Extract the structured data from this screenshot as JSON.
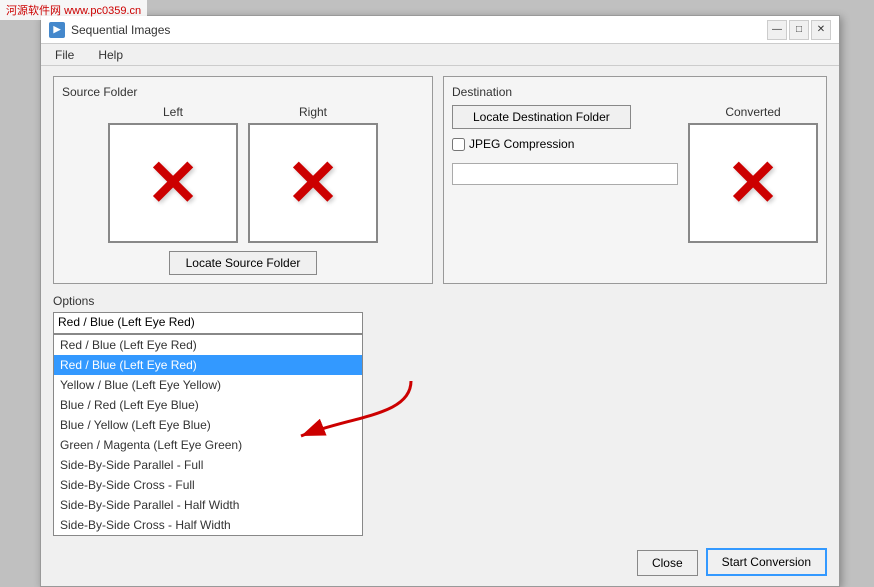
{
  "watermark": {
    "site": "www.pc0359.cn",
    "label": "河源软件网"
  },
  "window": {
    "title": "Sequential Images",
    "menu": {
      "file": "File",
      "help": "Help"
    }
  },
  "source_panel": {
    "title": "Source Folder",
    "left_label": "Left",
    "right_label": "Right",
    "locate_btn": "Locate Source Folder"
  },
  "dest_panel": {
    "title": "Destination",
    "converted_label": "Converted",
    "locate_btn": "Locate Destination Folder",
    "jpeg_label": "JPEG Compression"
  },
  "options": {
    "title": "Options",
    "current_value": "Red / Blue (Left Eye Red)",
    "items": [
      {
        "label": "Red / Blue (Left Eye Red)",
        "selected": false
      },
      {
        "label": "Red / Blue (Left Eye Red)",
        "selected": true
      },
      {
        "label": "Yellow / Blue  (Left Eye Yellow)",
        "selected": false
      },
      {
        "label": "Blue / Red (Left Eye Blue)",
        "selected": false
      },
      {
        "label": "Blue / Yellow (Left Eye Blue)",
        "selected": false
      },
      {
        "label": "Green / Magenta (Left Eye Green)",
        "selected": false
      },
      {
        "label": "Side-By-Side Parallel - Full",
        "selected": false
      },
      {
        "label": "Side-By-Side Cross - Full",
        "selected": false
      },
      {
        "label": "Side-By-Side Parallel - Half Width",
        "selected": false
      },
      {
        "label": "Side-By-Side Cross - Half Width",
        "selected": false
      }
    ]
  },
  "buttons": {
    "close": "Close",
    "start": "Start Conversion",
    "close2": "Close",
    "minimize": "—",
    "maximize": "□",
    "x": "✕"
  }
}
